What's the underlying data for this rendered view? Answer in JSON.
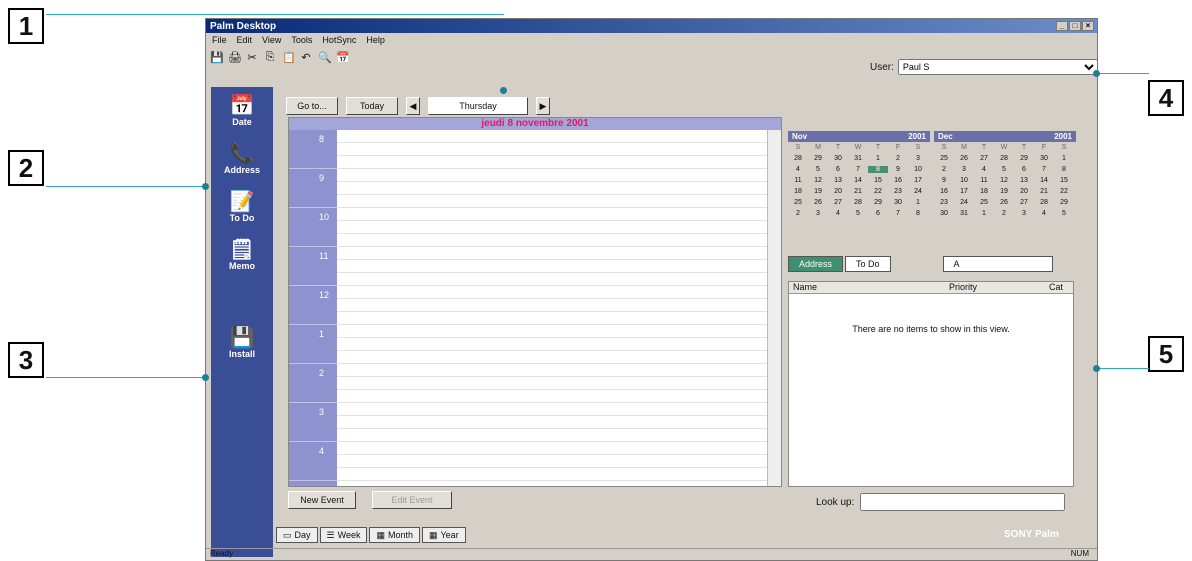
{
  "callouts": [
    "1",
    "2",
    "3",
    "4",
    "5"
  ],
  "window": {
    "title": "Palm Desktop",
    "controls": [
      "_",
      "□",
      "×"
    ]
  },
  "menu": [
    "File",
    "Edit",
    "View",
    "Tools",
    "HotSync",
    "Help"
  ],
  "toolbar": [
    "💾",
    "🖨",
    "✂",
    "⎘",
    "📋",
    "↶",
    "🔍",
    "📅"
  ],
  "user": {
    "label": "User:",
    "value": "Paul S"
  },
  "launcher": [
    {
      "label": "Date",
      "icon": "📅"
    },
    {
      "label": "Address",
      "icon": "📞"
    },
    {
      "label": "To Do",
      "icon": "📝"
    },
    {
      "label": "Memo",
      "icon": "🗒"
    },
    {
      "label": "Install",
      "icon": "💾"
    }
  ],
  "nav": {
    "goto": "Go to...",
    "today": "Today",
    "prev": "◀",
    "day": "Thursday",
    "next": "▶"
  },
  "day_header": "jeudi 8 novembre 2001",
  "hours": [
    "8",
    "9",
    "10",
    "11",
    "12",
    "1",
    "2",
    "3",
    "4",
    "5",
    "6"
  ],
  "buttons": {
    "new_event": "New Event",
    "edit_event": "Edit Event"
  },
  "calendars": [
    {
      "month": "Nov",
      "year": "2001",
      "days": [
        "S",
        "M",
        "T",
        "W",
        "T",
        "F",
        "S"
      ],
      "rows": [
        [
          "28",
          "29",
          "30",
          "31",
          "1",
          "2",
          "3"
        ],
        [
          "4",
          "5",
          "6",
          "7",
          "8",
          "9",
          "10"
        ],
        [
          "11",
          "12",
          "13",
          "14",
          "15",
          "16",
          "17"
        ],
        [
          "18",
          "19",
          "20",
          "21",
          "22",
          "23",
          "24"
        ],
        [
          "25",
          "26",
          "27",
          "28",
          "29",
          "30",
          "1"
        ],
        [
          "2",
          "3",
          "4",
          "5",
          "6",
          "7",
          "8"
        ]
      ]
    },
    {
      "month": "Dec",
      "year": "2001",
      "days": [
        "S",
        "M",
        "T",
        "W",
        "T",
        "F",
        "S"
      ],
      "rows": [
        [
          "25",
          "26",
          "27",
          "28",
          "29",
          "30",
          "1"
        ],
        [
          "2",
          "3",
          "4",
          "5",
          "6",
          "7",
          "8"
        ],
        [
          "9",
          "10",
          "11",
          "12",
          "13",
          "14",
          "15"
        ],
        [
          "16",
          "17",
          "18",
          "19",
          "20",
          "21",
          "22"
        ],
        [
          "23",
          "24",
          "25",
          "26",
          "27",
          "28",
          "29"
        ],
        [
          "30",
          "31",
          "1",
          "2",
          "3",
          "4",
          "5"
        ]
      ]
    }
  ],
  "tabs": {
    "address": "Address",
    "todo": "To Do",
    "filter": "A"
  },
  "list": {
    "columns": [
      "Name",
      "Priority",
      "Cat"
    ],
    "empty": "There are no items to show in this view."
  },
  "lookup": "Look up:",
  "views": [
    {
      "icon": "▭",
      "label": "Day"
    },
    {
      "icon": "☰",
      "label": "Week"
    },
    {
      "icon": "▦",
      "label": "Month"
    },
    {
      "icon": "▦",
      "label": "Year"
    }
  ],
  "brand": "SONY Palm",
  "status": {
    "left": "Ready",
    "right": "NUM"
  }
}
